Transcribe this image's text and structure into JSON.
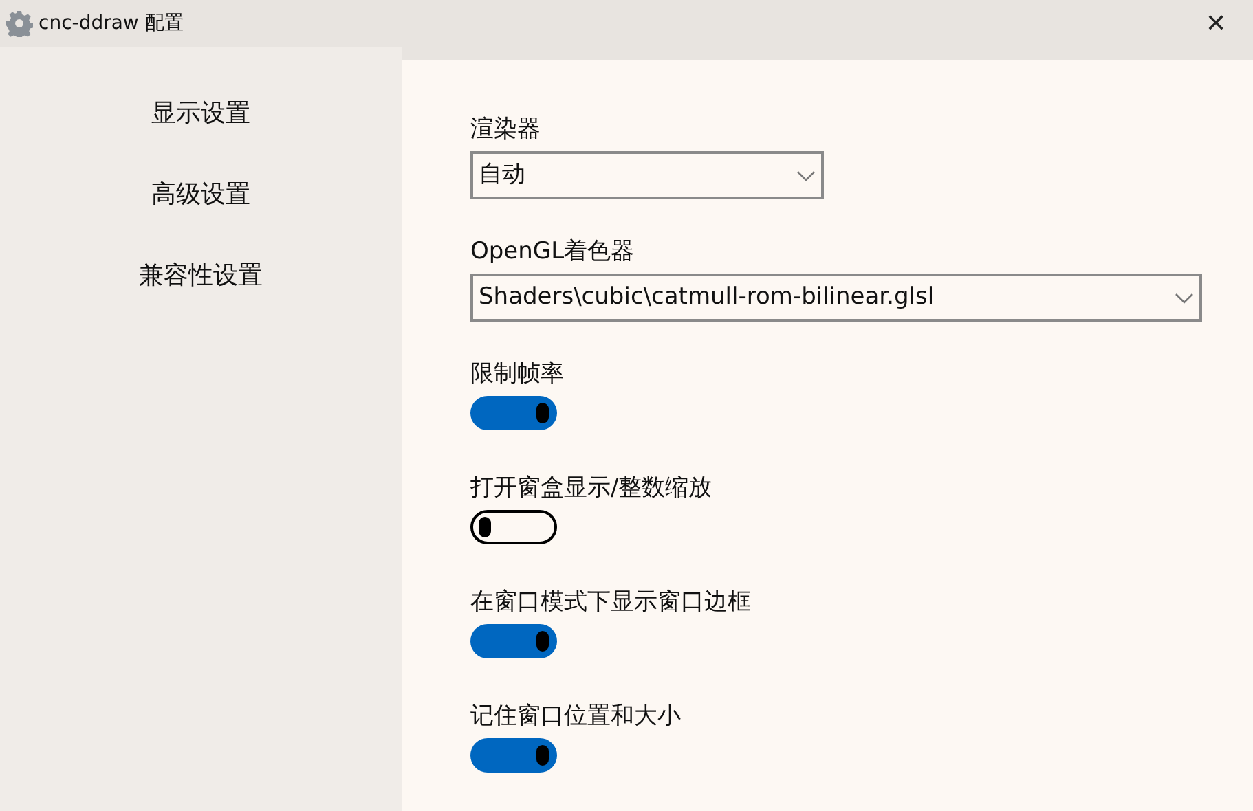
{
  "window": {
    "title": "cnc-ddraw 配置",
    "close": "✕"
  },
  "sidebar": {
    "items": [
      {
        "label": "显示设置"
      },
      {
        "label": "高级设置"
      },
      {
        "label": "兼容性设置"
      }
    ]
  },
  "settings": [
    {
      "kind": "select",
      "label": "渲染器",
      "value": "自动",
      "wide": false
    },
    {
      "kind": "select",
      "label": "OpenGL着色器",
      "value": "Shaders\\cubic\\catmull-rom-bilinear.glsl",
      "wide": true
    },
    {
      "kind": "toggle",
      "label": "限制帧率",
      "on": true
    },
    {
      "kind": "toggle",
      "label": "打开窗盒显示/整数缩放",
      "on": false
    },
    {
      "kind": "toggle",
      "label": "在窗口模式下显示窗口边框",
      "on": true
    },
    {
      "kind": "toggle",
      "label": "记住窗口位置和大小",
      "on": true
    }
  ]
}
